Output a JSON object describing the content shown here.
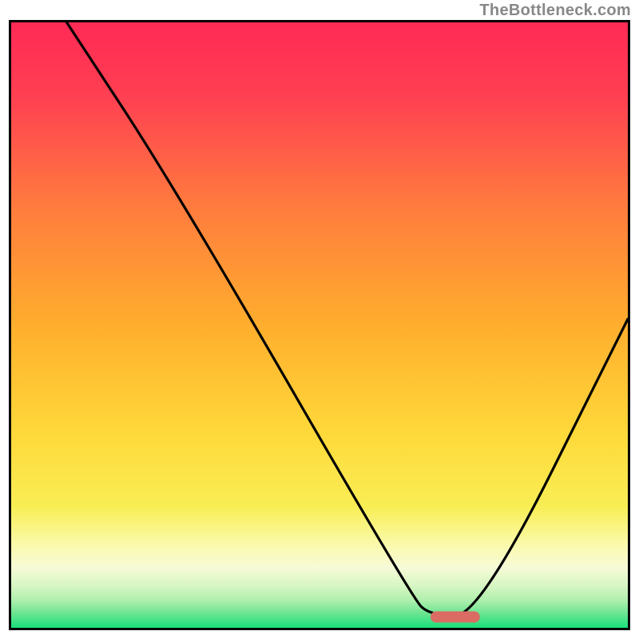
{
  "watermark": "TheBottleneck.com",
  "plot": {
    "inner_width": 772,
    "inner_height": 758
  },
  "chart_data": {
    "type": "line",
    "title": "",
    "xlabel": "",
    "ylabel": "",
    "xlim": [
      0,
      100
    ],
    "ylim": [
      0,
      100
    ],
    "grid": false,
    "gradient_bands": [
      {
        "name": "red-orange-yellow",
        "from": 0,
        "to": 80
      },
      {
        "name": "pale-yellow",
        "from": 80,
        "to": 88
      },
      {
        "name": "cream",
        "from": 88,
        "to": 92
      },
      {
        "name": "very-light-green",
        "from": 92,
        "to": 94
      },
      {
        "name": "light-green",
        "from": 94,
        "to": 96
      },
      {
        "name": "mint-green",
        "from": 96,
        "to": 98
      },
      {
        "name": "green",
        "from": 98,
        "to": 100
      }
    ],
    "curve_comment": "Piecewise V-shaped bottleneck curve; y is % distance from top (0=top, 100=bottom).",
    "curve": [
      {
        "x": 9,
        "y": 0
      },
      {
        "x": 27,
        "y": 28
      },
      {
        "x": 65,
        "y": 95
      },
      {
        "x": 68,
        "y": 98
      },
      {
        "x": 76,
        "y": 98
      },
      {
        "x": 100,
        "y": 49
      }
    ],
    "marker": {
      "shape": "rounded-bar",
      "x_start": 68,
      "x_end": 76,
      "y": 98.2,
      "color": "#da6c64"
    },
    "colors": {
      "top": "#ff2a55",
      "mid": "#ffd43b",
      "bottom": "#19e07a",
      "curve": "#000000",
      "marker": "#da6c64"
    }
  }
}
